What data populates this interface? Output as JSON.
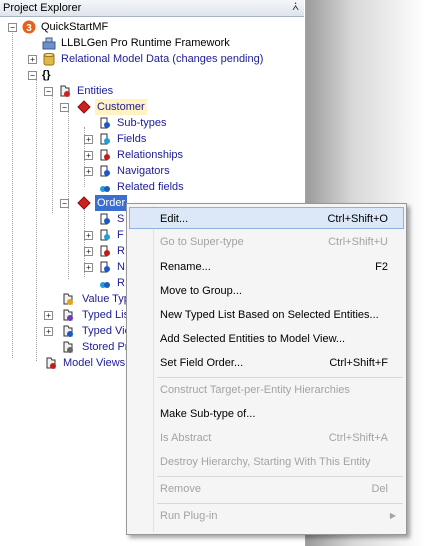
{
  "panel": {
    "title": "Project Explorer",
    "pin": "▪"
  },
  "tree": {
    "project": "QuickStartMF",
    "framework": "LLBLGen Pro Runtime Framework",
    "relational": "Relational Model Data (changes pending)",
    "root": "{}",
    "entities": "Entities",
    "customer": "Customer",
    "customer_children": [
      "Sub-types",
      "Fields",
      "Relationships",
      "Navigators",
      "Related fields"
    ],
    "order": "Order",
    "order_children": [
      "S",
      "F",
      "R",
      "N",
      "R"
    ],
    "value_types": "Value Typ",
    "typed_lists": "Typed Lis",
    "typed_views": "Typed Vie",
    "stored_procs": "Stored Pr",
    "model_views": "Model Views"
  },
  "menu": {
    "items": [
      {
        "label": "Edit...",
        "shortcut": "Ctrl+Shift+O",
        "enabled": true
      },
      {
        "label": "Go to Super-type",
        "shortcut": "Ctrl+Shift+U",
        "enabled": false
      },
      {
        "label": "Rename...",
        "shortcut": "F2",
        "enabled": true
      },
      {
        "label": "Move to Group...",
        "shortcut": "",
        "enabled": true
      },
      {
        "label": "New Typed List Based on Selected Entities...",
        "shortcut": "",
        "enabled": true
      },
      {
        "label": "Add Selected Entities to Model View...",
        "shortcut": "",
        "enabled": true
      },
      {
        "label": "Set Field Order...",
        "shortcut": "Ctrl+Shift+F",
        "enabled": true
      },
      {
        "label": "Construct Target-per-Entity Hierarchies",
        "shortcut": "",
        "enabled": false
      },
      {
        "label": "Make Sub-type of...",
        "shortcut": "",
        "enabled": true
      },
      {
        "label": "Is Abstract",
        "shortcut": "Ctrl+Shift+A",
        "enabled": false
      },
      {
        "label": "Destroy Hierarchy, Starting With This Entity",
        "shortcut": "",
        "enabled": false
      },
      {
        "label": "Remove",
        "shortcut": "Del",
        "enabled": false
      },
      {
        "label": "Run Plug-in",
        "shortcut": "",
        "enabled": false
      }
    ]
  },
  "colors": {
    "link": "#1c1c98",
    "selection": "#3a6fd0",
    "menu_hover": "#dce8f7"
  }
}
